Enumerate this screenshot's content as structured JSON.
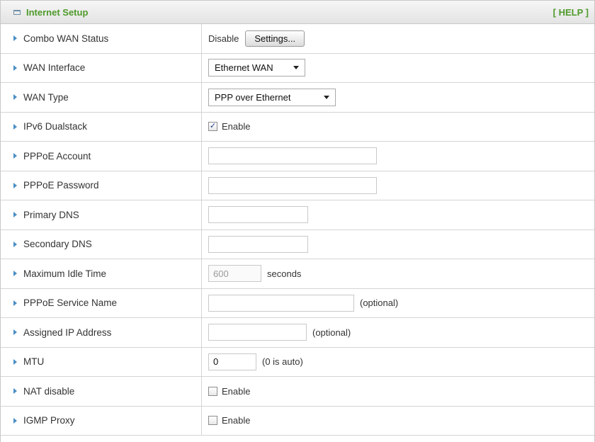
{
  "header": {
    "title": "Internet Setup",
    "help": "[ HELP ]"
  },
  "rows": {
    "combo": {
      "label": "Combo WAN Status",
      "value": "Disable",
      "button": "Settings..."
    },
    "wan_interface": {
      "label": "WAN Interface",
      "value": "Ethernet WAN"
    },
    "wan_type": {
      "label": "WAN Type",
      "value": "PPP over Ethernet"
    },
    "ipv6": {
      "label": "IPv6 Dualstack",
      "checkbox_label": "Enable",
      "checked": "✓"
    },
    "pppoe_account": {
      "label": "PPPoE Account",
      "value": ""
    },
    "pppoe_password": {
      "label": "PPPoE Password",
      "value": ""
    },
    "primary_dns": {
      "label": "Primary DNS",
      "value": ""
    },
    "secondary_dns": {
      "label": "Secondary DNS",
      "value": ""
    },
    "idle_time": {
      "label": "Maximum Idle Time",
      "placeholder": "600",
      "suffix": "seconds"
    },
    "service_name": {
      "label": "PPPoE Service Name",
      "value": "",
      "suffix": "(optional)"
    },
    "assigned_ip": {
      "label": "Assigned IP Address",
      "value": "",
      "suffix": "(optional)"
    },
    "mtu": {
      "label": "MTU",
      "value": "0",
      "suffix": "(0 is auto)"
    },
    "nat": {
      "label": "NAT disable",
      "checkbox_label": "Enable"
    },
    "igmp": {
      "label": "IGMP Proxy",
      "checkbox_label": "Enable"
    }
  },
  "colors": {
    "title_green": "#4e9a2a",
    "arrow_blue": "#4a8ec4"
  }
}
